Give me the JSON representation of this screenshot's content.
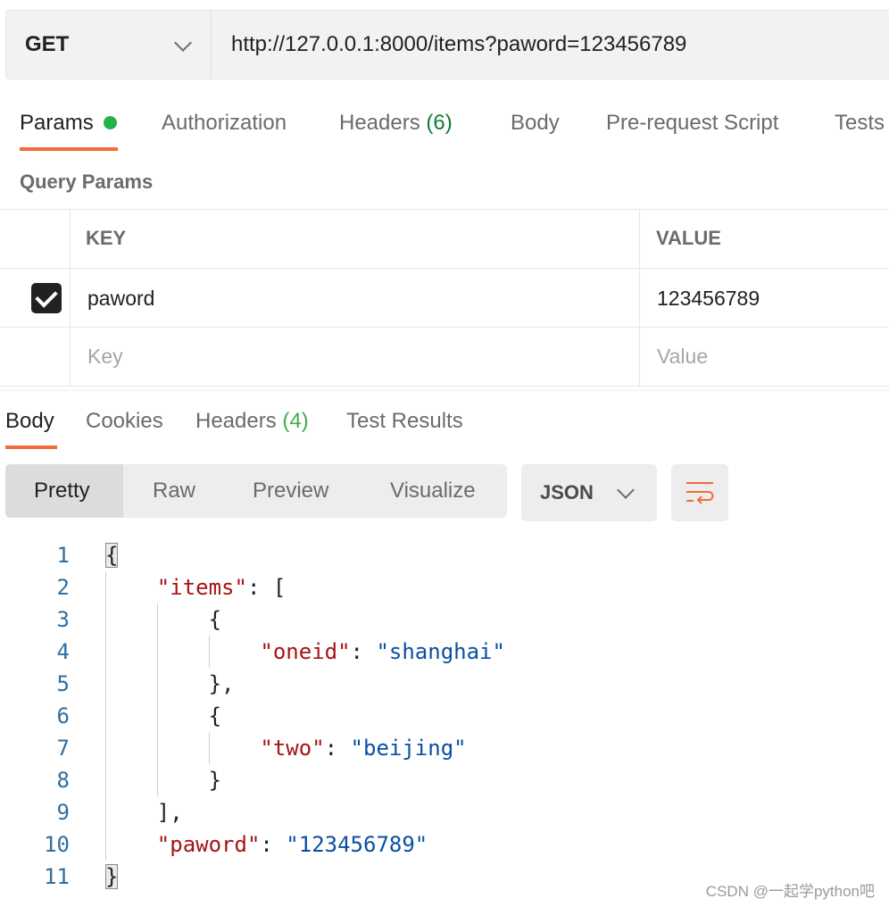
{
  "request": {
    "method": "GET",
    "url": "http://127.0.0.1:8000/items?paword=123456789"
  },
  "request_tabs": [
    {
      "label": "Params"
    },
    {
      "label": "Authorization"
    },
    {
      "label": "Headers",
      "count": "(6)"
    },
    {
      "label": "Body"
    },
    {
      "label": "Pre-request Script"
    },
    {
      "label": "Tests"
    }
  ],
  "query_params": {
    "title": "Query Params",
    "columns": {
      "key": "KEY",
      "value": "VALUE"
    },
    "rows": [
      {
        "checked": true,
        "key": "paword",
        "value": "123456789"
      }
    ],
    "placeholders": {
      "key": "Key",
      "value": "Value"
    }
  },
  "response_tabs": [
    {
      "label": "Body"
    },
    {
      "label": "Cookies"
    },
    {
      "label": "Headers",
      "count": "(4)"
    },
    {
      "label": "Test Results"
    }
  ],
  "view_modes": [
    "Pretty",
    "Raw",
    "Preview",
    "Visualize"
  ],
  "format": "JSON",
  "code": {
    "line_numbers": [
      "1",
      "2",
      "3",
      "4",
      "5",
      "6",
      "7",
      "8",
      "9",
      "10",
      "11"
    ],
    "items_key": "\"items\"",
    "oneid_key": "\"oneid\"",
    "oneid_value": "\"shanghai\"",
    "two_key": "\"two\"",
    "two_value": "\"beijing\"",
    "paword_key": "\"paword\"",
    "paword_value": "\"123456789\""
  },
  "watermark": "CSDN @一起学python吧",
  "icons": {
    "method_dropdown": "chevron-down-icon",
    "format_dropdown": "chevron-down-icon",
    "wrap": "wrap-lines-icon",
    "checkbox": "checkbox-checked-icon",
    "params_status": "green-dot-icon"
  },
  "colors": {
    "accent": "#f26b3a",
    "dot": "#26b048",
    "count_dark_green": "#0f7c2e",
    "count_green": "#3fae4e",
    "json_key": "#a31515",
    "json_string": "#0b4fa0",
    "line_number": "#2f6f9f"
  }
}
